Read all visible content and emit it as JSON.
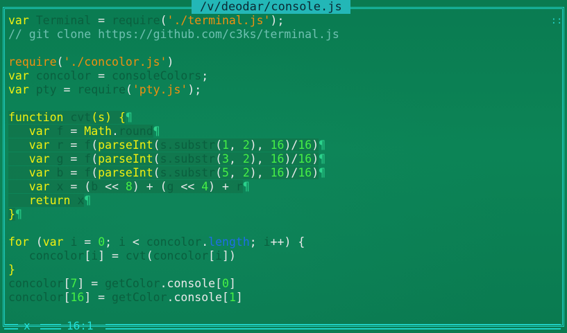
{
  "window": {
    "title": "/v/deodar/console.js",
    "scroll_indicator": "::"
  },
  "status": {
    "mode": "x",
    "position": "16:1"
  },
  "code": [
    [
      {
        "t": "var",
        "c": "kw"
      },
      {
        "t": " ",
        "c": "id"
      },
      {
        "t": "Terminal",
        "c": "dim"
      },
      {
        "t": " = ",
        "c": "id"
      },
      {
        "t": "require",
        "c": "dim"
      },
      {
        "t": "(",
        "c": "id"
      },
      {
        "t": "'./terminal.js'",
        "c": "str"
      },
      {
        "t": ");",
        "c": "id"
      }
    ],
    [
      {
        "t": "// git clone https://github.com/c3ks/terminal.js",
        "c": "cmt"
      }
    ],
    [],
    [
      {
        "t": "require",
        "c": "str"
      },
      {
        "t": "(",
        "c": "id"
      },
      {
        "t": "'./concolor.js'",
        "c": "str"
      },
      {
        "t": ")",
        "c": "id"
      }
    ],
    [
      {
        "t": "var",
        "c": "kw"
      },
      {
        "t": " ",
        "c": "id"
      },
      {
        "t": "concolor",
        "c": "dim"
      },
      {
        "t": " = ",
        "c": "id"
      },
      {
        "t": "consoleColors",
        "c": "dim"
      },
      {
        "t": ";",
        "c": "id"
      }
    ],
    [
      {
        "t": "var",
        "c": "kw"
      },
      {
        "t": " ",
        "c": "id"
      },
      {
        "t": "pty",
        "c": "dim"
      },
      {
        "t": " = ",
        "c": "id"
      },
      {
        "t": "require",
        "c": "dim"
      },
      {
        "t": "(",
        "c": "id"
      },
      {
        "t": "'pty.js'",
        "c": "str"
      },
      {
        "t": ");",
        "c": "id"
      }
    ],
    [],
    [
      {
        "t": "function",
        "c": "kw hl"
      },
      {
        "t": " ",
        "c": "id hl"
      },
      {
        "t": "cvt",
        "c": "dim hl"
      },
      {
        "t": "(s) {",
        "c": "kw hl"
      },
      {
        "t": "¶",
        "c": "pil"
      }
    ],
    [
      {
        "t": "   var",
        "c": "kw hl"
      },
      {
        "t": " ",
        "c": "id hl"
      },
      {
        "t": "f",
        "c": "dim hl"
      },
      {
        "t": " = ",
        "c": "id hl"
      },
      {
        "t": "Math",
        "c": "kw hl"
      },
      {
        "t": ".",
        "c": "id hl"
      },
      {
        "t": "round",
        "c": "dim hl"
      },
      {
        "t": "¶",
        "c": "pil"
      }
    ],
    [
      {
        "t": "   var",
        "c": "kw hl"
      },
      {
        "t": " ",
        "c": "id hl"
      },
      {
        "t": "r",
        "c": "dim hl"
      },
      {
        "t": " = ",
        "c": "id hl"
      },
      {
        "t": "f",
        "c": "dim hl"
      },
      {
        "t": "(",
        "c": "id hl"
      },
      {
        "t": "parseInt",
        "c": "kw hl"
      },
      {
        "t": "(",
        "c": "id hl"
      },
      {
        "t": "s.substr",
        "c": "dim hl"
      },
      {
        "t": "(",
        "c": "id hl"
      },
      {
        "t": "1",
        "c": "num hl"
      },
      {
        "t": ", ",
        "c": "id hl"
      },
      {
        "t": "2",
        "c": "num hl"
      },
      {
        "t": "), ",
        "c": "id hl"
      },
      {
        "t": "16",
        "c": "num hl"
      },
      {
        "t": ")/",
        "c": "id hl"
      },
      {
        "t": "16",
        "c": "num hl"
      },
      {
        "t": ")",
        "c": "id hl"
      },
      {
        "t": "¶",
        "c": "pil"
      }
    ],
    [
      {
        "t": "   var",
        "c": "kw hl"
      },
      {
        "t": " ",
        "c": "id hl"
      },
      {
        "t": "g",
        "c": "dim hl"
      },
      {
        "t": " = ",
        "c": "id hl"
      },
      {
        "t": "f",
        "c": "dim hl"
      },
      {
        "t": "(",
        "c": "id hl"
      },
      {
        "t": "parseInt",
        "c": "kw hl"
      },
      {
        "t": "(",
        "c": "id hl"
      },
      {
        "t": "s.substr",
        "c": "dim hl"
      },
      {
        "t": "(",
        "c": "id hl"
      },
      {
        "t": "3",
        "c": "num hl"
      },
      {
        "t": ", ",
        "c": "id hl"
      },
      {
        "t": "2",
        "c": "num hl"
      },
      {
        "t": "), ",
        "c": "id hl"
      },
      {
        "t": "16",
        "c": "num hl"
      },
      {
        "t": ")/",
        "c": "id hl"
      },
      {
        "t": "16",
        "c": "num hl"
      },
      {
        "t": ")",
        "c": "id hl"
      },
      {
        "t": "¶",
        "c": "pil"
      }
    ],
    [
      {
        "t": "   var",
        "c": "kw hl"
      },
      {
        "t": " ",
        "c": "id hl"
      },
      {
        "t": "b",
        "c": "dim hl"
      },
      {
        "t": " = ",
        "c": "id hl"
      },
      {
        "t": "f",
        "c": "dim hl"
      },
      {
        "t": "(",
        "c": "id hl"
      },
      {
        "t": "parseInt",
        "c": "kw hl"
      },
      {
        "t": "(",
        "c": "id hl"
      },
      {
        "t": "s.substr",
        "c": "dim hl"
      },
      {
        "t": "(",
        "c": "id hl"
      },
      {
        "t": "5",
        "c": "num hl"
      },
      {
        "t": ", ",
        "c": "id hl"
      },
      {
        "t": "2",
        "c": "num hl"
      },
      {
        "t": "), ",
        "c": "id hl"
      },
      {
        "t": "16",
        "c": "num hl"
      },
      {
        "t": ")/",
        "c": "id hl"
      },
      {
        "t": "16",
        "c": "num hl"
      },
      {
        "t": ")",
        "c": "id hl"
      },
      {
        "t": "¶",
        "c": "pil"
      }
    ],
    [
      {
        "t": "   var",
        "c": "kw hl"
      },
      {
        "t": " ",
        "c": "id hl"
      },
      {
        "t": "x",
        "c": "dim hl"
      },
      {
        "t": " = (",
        "c": "id hl"
      },
      {
        "t": "b",
        "c": "dim hl"
      },
      {
        "t": " << ",
        "c": "id hl"
      },
      {
        "t": "8",
        "c": "num hl"
      },
      {
        "t": ") + (",
        "c": "id hl"
      },
      {
        "t": "g",
        "c": "dim hl"
      },
      {
        "t": " << ",
        "c": "id hl"
      },
      {
        "t": "4",
        "c": "num hl"
      },
      {
        "t": ") + ",
        "c": "id hl"
      },
      {
        "t": "r",
        "c": "dim hl"
      },
      {
        "t": "¶",
        "c": "pil"
      }
    ],
    [
      {
        "t": "   return",
        "c": "kw hl"
      },
      {
        "t": " ",
        "c": "id hl"
      },
      {
        "t": "x",
        "c": "dim hl"
      },
      {
        "t": "¶",
        "c": "pil"
      }
    ],
    [
      {
        "t": "}",
        "c": "kw hl"
      },
      {
        "t": "¶",
        "c": "pil"
      }
    ],
    [],
    [
      {
        "t": "for",
        "c": "kw"
      },
      {
        "t": " (",
        "c": "id"
      },
      {
        "t": "var",
        "c": "kw"
      },
      {
        "t": " ",
        "c": "id"
      },
      {
        "t": "i",
        "c": "dim"
      },
      {
        "t": " = ",
        "c": "id"
      },
      {
        "t": "0",
        "c": "num"
      },
      {
        "t": "; ",
        "c": "id"
      },
      {
        "t": "i",
        "c": "dim"
      },
      {
        "t": " < ",
        "c": "id"
      },
      {
        "t": "concolor",
        "c": "dim"
      },
      {
        "t": ".",
        "c": "id"
      },
      {
        "t": "length",
        "c": "blue"
      },
      {
        "t": "; ",
        "c": "id"
      },
      {
        "t": "i",
        "c": "dim"
      },
      {
        "t": "++) {",
        "c": "id"
      }
    ],
    [
      {
        "t": "   concolor",
        "c": "dim"
      },
      {
        "t": "[",
        "c": "id"
      },
      {
        "t": "i",
        "c": "dim"
      },
      {
        "t": "] = ",
        "c": "id"
      },
      {
        "t": "cvt",
        "c": "dim"
      },
      {
        "t": "(",
        "c": "id"
      },
      {
        "t": "concolor",
        "c": "dim"
      },
      {
        "t": "[",
        "c": "id"
      },
      {
        "t": "i",
        "c": "dim"
      },
      {
        "t": "])",
        "c": "id"
      }
    ],
    [
      {
        "t": "}",
        "c": "kw"
      }
    ],
    [
      {
        "t": "concolor",
        "c": "dim"
      },
      {
        "t": "[",
        "c": "id"
      },
      {
        "t": "7",
        "c": "num"
      },
      {
        "t": "] = ",
        "c": "id"
      },
      {
        "t": "getColor",
        "c": "dim"
      },
      {
        "t": ".console[",
        "c": "id"
      },
      {
        "t": "0",
        "c": "num"
      },
      {
        "t": "]",
        "c": "id"
      }
    ],
    [
      {
        "t": "concolor",
        "c": "dim"
      },
      {
        "t": "[",
        "c": "id"
      },
      {
        "t": "16",
        "c": "num"
      },
      {
        "t": "] = ",
        "c": "id"
      },
      {
        "t": "getColor",
        "c": "dim"
      },
      {
        "t": ".console[",
        "c": "id"
      },
      {
        "t": "1",
        "c": "num"
      },
      {
        "t": "]",
        "c": "id"
      }
    ]
  ],
  "colors": {
    "background": "#0b7a4f",
    "border": "#1fd0c4",
    "title_bg": "#23b7b7",
    "keyword": "#f2f010",
    "string": "#f09010",
    "comment": "#6fc1b1",
    "number": "#46f046",
    "property": "#1e6ee6"
  }
}
